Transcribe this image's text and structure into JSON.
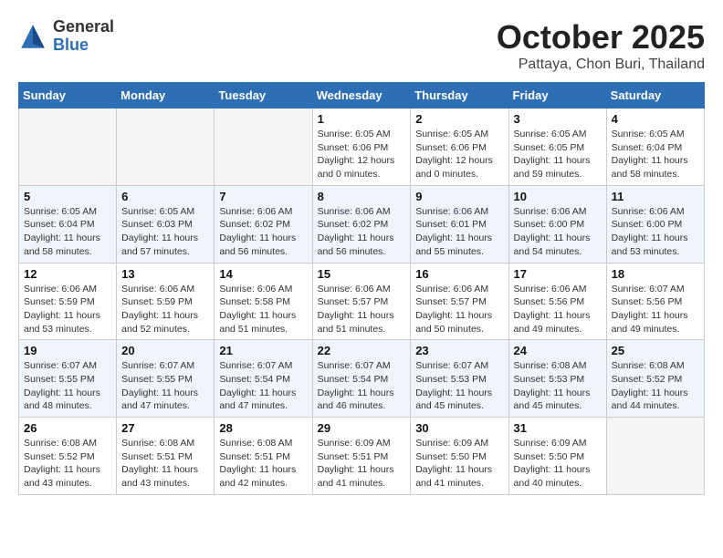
{
  "header": {
    "logo_general": "General",
    "logo_blue": "Blue",
    "month_title": "October 2025",
    "location": "Pattaya, Chon Buri, Thailand"
  },
  "weekdays": [
    "Sunday",
    "Monday",
    "Tuesday",
    "Wednesday",
    "Thursday",
    "Friday",
    "Saturday"
  ],
  "weeks": [
    [
      {
        "day": "",
        "info": ""
      },
      {
        "day": "",
        "info": ""
      },
      {
        "day": "",
        "info": ""
      },
      {
        "day": "1",
        "info": "Sunrise: 6:05 AM\nSunset: 6:06 PM\nDaylight: 12 hours\nand 0 minutes."
      },
      {
        "day": "2",
        "info": "Sunrise: 6:05 AM\nSunset: 6:06 PM\nDaylight: 12 hours\nand 0 minutes."
      },
      {
        "day": "3",
        "info": "Sunrise: 6:05 AM\nSunset: 6:05 PM\nDaylight: 11 hours\nand 59 minutes."
      },
      {
        "day": "4",
        "info": "Sunrise: 6:05 AM\nSunset: 6:04 PM\nDaylight: 11 hours\nand 58 minutes."
      }
    ],
    [
      {
        "day": "5",
        "info": "Sunrise: 6:05 AM\nSunset: 6:04 PM\nDaylight: 11 hours\nand 58 minutes."
      },
      {
        "day": "6",
        "info": "Sunrise: 6:05 AM\nSunset: 6:03 PM\nDaylight: 11 hours\nand 57 minutes."
      },
      {
        "day": "7",
        "info": "Sunrise: 6:06 AM\nSunset: 6:02 PM\nDaylight: 11 hours\nand 56 minutes."
      },
      {
        "day": "8",
        "info": "Sunrise: 6:06 AM\nSunset: 6:02 PM\nDaylight: 11 hours\nand 56 minutes."
      },
      {
        "day": "9",
        "info": "Sunrise: 6:06 AM\nSunset: 6:01 PM\nDaylight: 11 hours\nand 55 minutes."
      },
      {
        "day": "10",
        "info": "Sunrise: 6:06 AM\nSunset: 6:00 PM\nDaylight: 11 hours\nand 54 minutes."
      },
      {
        "day": "11",
        "info": "Sunrise: 6:06 AM\nSunset: 6:00 PM\nDaylight: 11 hours\nand 53 minutes."
      }
    ],
    [
      {
        "day": "12",
        "info": "Sunrise: 6:06 AM\nSunset: 5:59 PM\nDaylight: 11 hours\nand 53 minutes."
      },
      {
        "day": "13",
        "info": "Sunrise: 6:06 AM\nSunset: 5:59 PM\nDaylight: 11 hours\nand 52 minutes."
      },
      {
        "day": "14",
        "info": "Sunrise: 6:06 AM\nSunset: 5:58 PM\nDaylight: 11 hours\nand 51 minutes."
      },
      {
        "day": "15",
        "info": "Sunrise: 6:06 AM\nSunset: 5:57 PM\nDaylight: 11 hours\nand 51 minutes."
      },
      {
        "day": "16",
        "info": "Sunrise: 6:06 AM\nSunset: 5:57 PM\nDaylight: 11 hours\nand 50 minutes."
      },
      {
        "day": "17",
        "info": "Sunrise: 6:06 AM\nSunset: 5:56 PM\nDaylight: 11 hours\nand 49 minutes."
      },
      {
        "day": "18",
        "info": "Sunrise: 6:07 AM\nSunset: 5:56 PM\nDaylight: 11 hours\nand 49 minutes."
      }
    ],
    [
      {
        "day": "19",
        "info": "Sunrise: 6:07 AM\nSunset: 5:55 PM\nDaylight: 11 hours\nand 48 minutes."
      },
      {
        "day": "20",
        "info": "Sunrise: 6:07 AM\nSunset: 5:55 PM\nDaylight: 11 hours\nand 47 minutes."
      },
      {
        "day": "21",
        "info": "Sunrise: 6:07 AM\nSunset: 5:54 PM\nDaylight: 11 hours\nand 47 minutes."
      },
      {
        "day": "22",
        "info": "Sunrise: 6:07 AM\nSunset: 5:54 PM\nDaylight: 11 hours\nand 46 minutes."
      },
      {
        "day": "23",
        "info": "Sunrise: 6:07 AM\nSunset: 5:53 PM\nDaylight: 11 hours\nand 45 minutes."
      },
      {
        "day": "24",
        "info": "Sunrise: 6:08 AM\nSunset: 5:53 PM\nDaylight: 11 hours\nand 45 minutes."
      },
      {
        "day": "25",
        "info": "Sunrise: 6:08 AM\nSunset: 5:52 PM\nDaylight: 11 hours\nand 44 minutes."
      }
    ],
    [
      {
        "day": "26",
        "info": "Sunrise: 6:08 AM\nSunset: 5:52 PM\nDaylight: 11 hours\nand 43 minutes."
      },
      {
        "day": "27",
        "info": "Sunrise: 6:08 AM\nSunset: 5:51 PM\nDaylight: 11 hours\nand 43 minutes."
      },
      {
        "day": "28",
        "info": "Sunrise: 6:08 AM\nSunset: 5:51 PM\nDaylight: 11 hours\nand 42 minutes."
      },
      {
        "day": "29",
        "info": "Sunrise: 6:09 AM\nSunset: 5:51 PM\nDaylight: 11 hours\nand 41 minutes."
      },
      {
        "day": "30",
        "info": "Sunrise: 6:09 AM\nSunset: 5:50 PM\nDaylight: 11 hours\nand 41 minutes."
      },
      {
        "day": "31",
        "info": "Sunrise: 6:09 AM\nSunset: 5:50 PM\nDaylight: 11 hours\nand 40 minutes."
      },
      {
        "day": "",
        "info": ""
      }
    ]
  ]
}
